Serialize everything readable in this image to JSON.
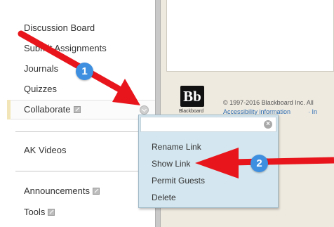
{
  "sidebar": {
    "items": [
      {
        "label": "Discussion Board"
      },
      {
        "label": "Submit Assignments"
      },
      {
        "label": "Journals"
      },
      {
        "label": "Quizzes"
      },
      {
        "label": "Collaborate"
      },
      {
        "label": "AK Videos"
      },
      {
        "label": "Announcements"
      },
      {
        "label": "Tools"
      }
    ]
  },
  "footer": {
    "logo_text": "Bb",
    "logo_caption": "Blackboard",
    "copyright": "© 1997-2016 Blackboard Inc. All",
    "accessibility_link": "Accessibility information",
    "separator": "·  In"
  },
  "context_menu": {
    "items": [
      {
        "label": "Rename Link"
      },
      {
        "label": "Show Link"
      },
      {
        "label": "Permit Guests"
      },
      {
        "label": "Delete"
      }
    ]
  },
  "annotations": {
    "step1": "1",
    "step2": "2",
    "arrow_color": "#e8161c",
    "badge_color": "#3e8fe0"
  },
  "colors": {
    "content_bg": "#efeae0",
    "popup_bg": "#d4e6ef",
    "link": "#2a6bb0"
  }
}
